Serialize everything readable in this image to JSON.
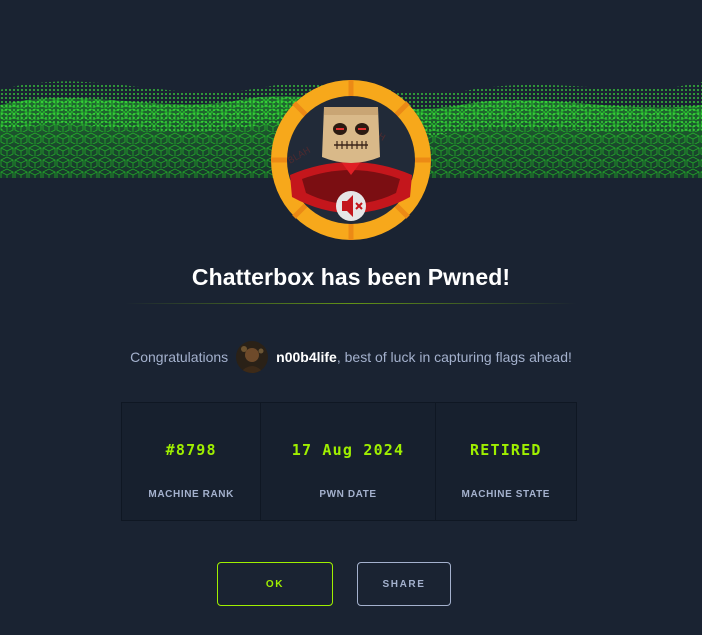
{
  "modal": {
    "title": "Chatterbox has been Pwned!",
    "machine_name": "Chatterbox",
    "congrats": {
      "prefix": "Congratulations",
      "username": "n00b4life",
      "suffix": ", best of luck in capturing flags ahead!"
    },
    "stats": [
      {
        "value": "#8798",
        "label": "MACHINE RANK"
      },
      {
        "value": "17 Aug 2024",
        "label": "PWN DATE"
      },
      {
        "value": "RETIRED",
        "label": "MACHINE STATE"
      }
    ],
    "buttons": {
      "ok_label": "OK",
      "share_label": "SHARE"
    }
  },
  "icons": {
    "machine_avatar": "paper-bag-mask-icon",
    "os_badge": "muted-speaker-icon",
    "user_avatar": "user-avatar"
  },
  "colors": {
    "background": "#1a2332",
    "accent": "#9fef00",
    "muted_text": "#a4b1cd",
    "ring_orange": "#f7a81b",
    "ring_dark": "#ee8f1e"
  }
}
